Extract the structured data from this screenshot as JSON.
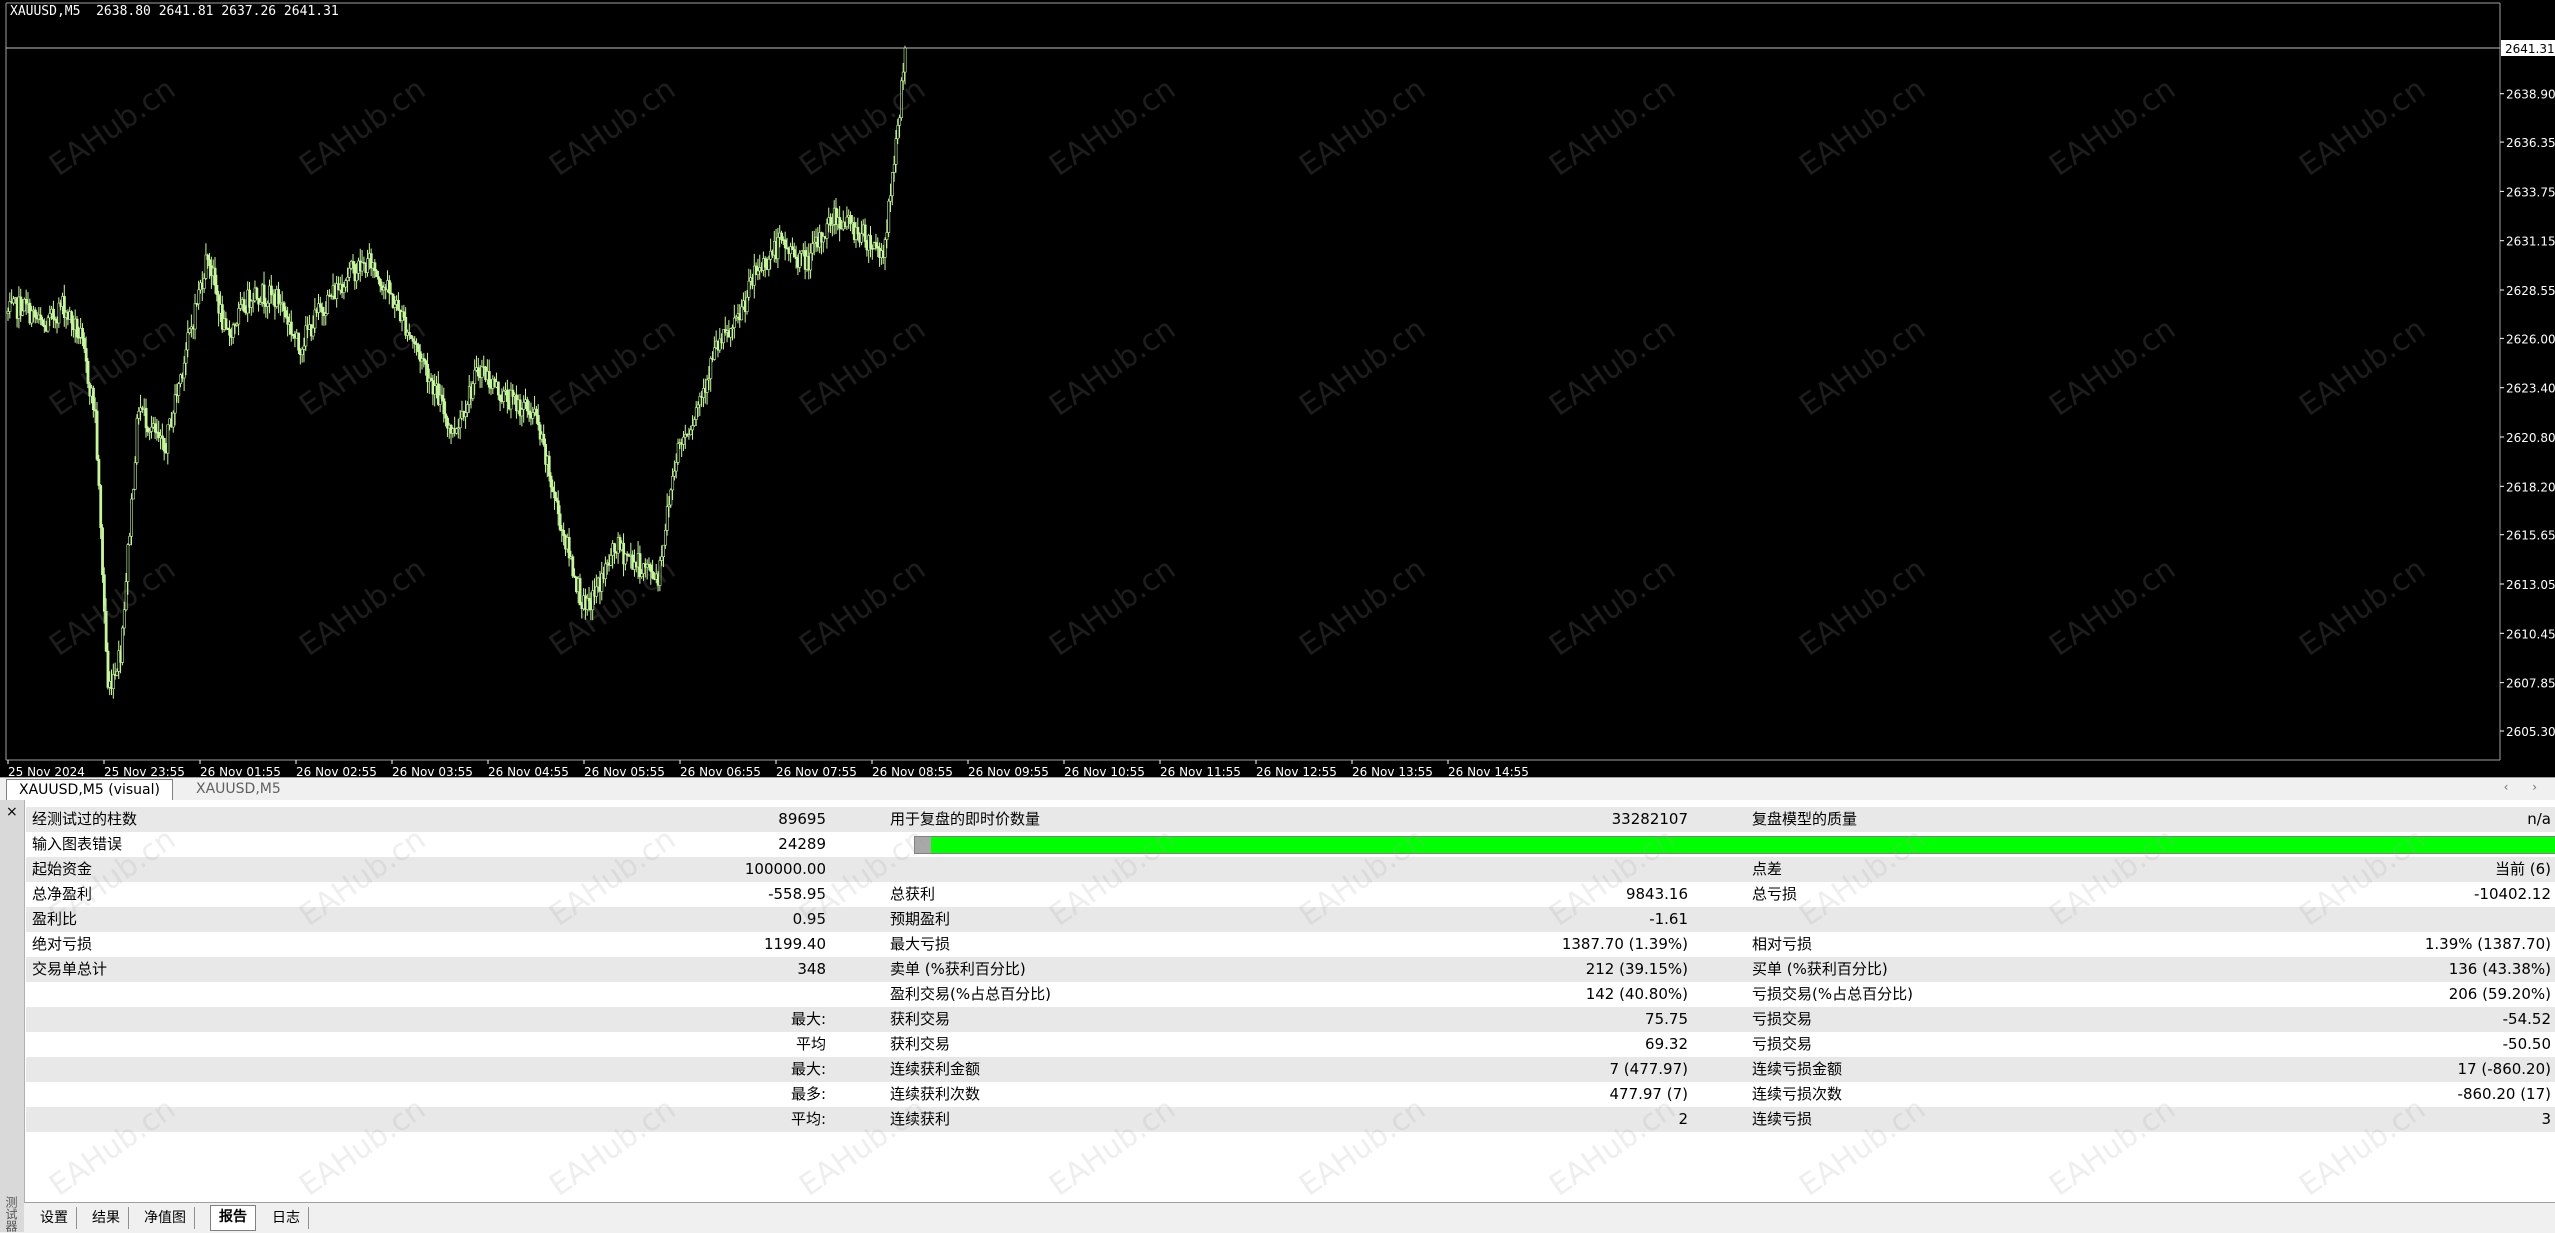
{
  "chart": {
    "header": "XAUUSD,M5  2638.80 2641.81 2637.26 2641.31",
    "current_price_label": "2641.31",
    "price_labels": [
      "2638.90",
      "2636.35",
      "2633.75",
      "2631.15",
      "2628.55",
      "2626.00",
      "2623.40",
      "2620.80",
      "2618.20",
      "2615.65",
      "2613.05",
      "2610.45",
      "2607.85",
      "2605.30"
    ],
    "time_labels": [
      "25 Nov 2024",
      "25 Nov 23:55",
      "26 Nov 01:55",
      "26 Nov 02:55",
      "26 Nov 03:55",
      "26 Nov 04:55",
      "26 Nov 05:55",
      "26 Nov 06:55",
      "26 Nov 07:55",
      "26 Nov 08:55",
      "26 Nov 09:55",
      "26 Nov 10:55",
      "26 Nov 11:55",
      "26 Nov 12:55",
      "26 Nov 13:55",
      "26 Nov 14:55"
    ],
    "colors": {
      "background": "#000000",
      "candle": "#c8f7a0",
      "bull_body": "#000000",
      "bear_body": "#c8f7a0",
      "axis": "#ffffff"
    },
    "tabs": [
      {
        "label": "XAUUSD,M5 (visual)",
        "active": true
      },
      {
        "label": "XAUUSD,M5",
        "active": false
      }
    ],
    "watermark": "EAHub.cn"
  },
  "report": {
    "rows": [
      {
        "l1": "经测试过的柱数",
        "v1": "89695",
        "l2": "用于复盘的即时价数量",
        "v2": "33282107",
        "l3": "复盘模型的质量",
        "v3": "n/a"
      },
      {
        "l1": "输入图表错误",
        "v1": "24289",
        "progress": true
      },
      {
        "l1": "起始资金",
        "v1": "100000.00",
        "l3": "点差",
        "v3": "当前 (6)"
      },
      {
        "l1": "总净盈利",
        "v1": "-558.95",
        "l2": "总获利",
        "v2": "9843.16",
        "l3": "总亏损",
        "v3": "-10402.12"
      },
      {
        "l1": "盈利比",
        "v1": "0.95",
        "l2": "预期盈利",
        "v2": "-1.61"
      },
      {
        "l1": "绝对亏损",
        "v1": "1199.40",
        "l2": "最大亏损",
        "v2": "1387.70 (1.39%)",
        "l3": "相对亏损",
        "v3": "1.39% (1387.70)"
      },
      {
        "l1": "交易单总计",
        "v1": "348",
        "l2": "卖单 (%获利百分比)",
        "v2": "212 (39.15%)",
        "l3": "买单 (%获利百分比)",
        "v3": "136 (43.38%)"
      },
      {
        "l2": "盈利交易(%占总百分比)",
        "v2": "142 (40.80%)",
        "l3": "亏损交易(%占总百分比)",
        "v3": "206 (59.20%)"
      },
      {
        "v1": "最大:",
        "l2": "获利交易",
        "v2": "75.75",
        "l3": "亏损交易",
        "v3": "-54.52"
      },
      {
        "v1": "平均",
        "l2": "获利交易",
        "v2": "69.32",
        "l3": "亏损交易",
        "v3": "-50.50"
      },
      {
        "v1": "最大:",
        "l2": "连续获利金额",
        "v2": "7 (477.97)",
        "l3": "连续亏损金额",
        "v3": "17 (-860.20)"
      },
      {
        "v1": "最多:",
        "l2": "连续获利次数",
        "v2": "477.97 (7)",
        "l3": "连续亏损次数",
        "v3": "-860.20 (17)"
      },
      {
        "v1": "平均:",
        "l2": "连续获利",
        "v2": "2",
        "l3": "连续亏损",
        "v3": "3"
      }
    ],
    "progress_color": "#00ff00"
  },
  "bottom_tabs": [
    {
      "label": "设置",
      "active": false
    },
    {
      "label": "结果",
      "active": false
    },
    {
      "label": "净值图",
      "active": false
    },
    {
      "label": "报告",
      "active": true
    },
    {
      "label": "日志",
      "active": false
    }
  ],
  "side": {
    "close": "×",
    "label": "测试器"
  }
}
